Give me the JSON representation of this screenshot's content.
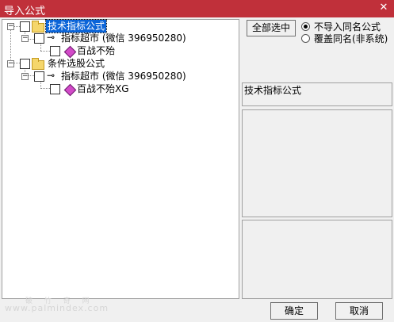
{
  "window": {
    "title": "导入公式",
    "close_glyph": "✕"
  },
  "tree": {
    "nodes": [
      {
        "label": "技术指标公式",
        "expander": "−",
        "selected": true
      },
      {
        "label": "指标超市 (微信 396950280)",
        "expander": "−"
      },
      {
        "label": "百战不殆"
      },
      {
        "label": "条件选股公式",
        "expander": "−"
      },
      {
        "label": "指标超市 (微信 396950280)",
        "expander": "−"
      },
      {
        "label": "百战不殆XG"
      }
    ]
  },
  "options": {
    "select_all_label": "全部选中",
    "radio_no_import": "不导入同名公式",
    "radio_overwrite": "覆盖同名(非系统)",
    "selected_option": "不导入同名公式"
  },
  "details": {
    "formula_name": "技术指标公式"
  },
  "buttons": {
    "ok_label": "确定",
    "cancel_label": "取消"
  },
  "watermark": {
    "top": "破 竹 奇 网",
    "url": "www.palmindex.com"
  }
}
